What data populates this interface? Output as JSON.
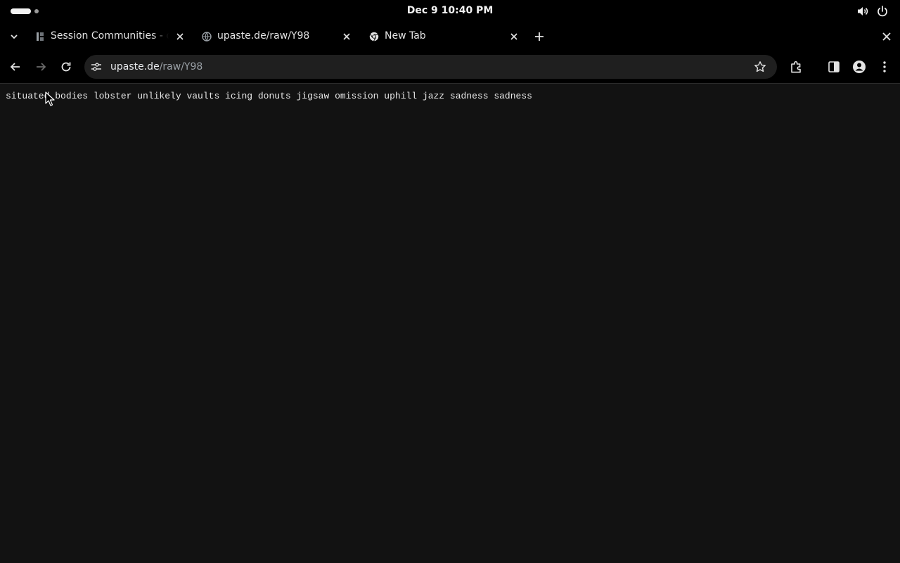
{
  "system_bar": {
    "clock": "Dec 9  10:40 PM",
    "volume_icon": "volume-icon",
    "power_icon": "power-icon"
  },
  "tabs": [
    {
      "title": "Session Communities - o",
      "favicon": "session-icon",
      "active": false
    },
    {
      "title": "upaste.de/raw/Y98",
      "favicon": "globe-icon",
      "active": true
    },
    {
      "title": "New Tab",
      "favicon": "chrome-icon",
      "active": false
    }
  ],
  "address_bar": {
    "host": "upaste.de",
    "path": "/raw/Y98"
  },
  "page": {
    "text": "situated bodies lobster unlikely vaults icing donuts jigsaw omission uphill jazz sadness sadness"
  },
  "colors": {
    "top_bar": "#000000",
    "page_background": "#121212",
    "omnibox": "#1f1f1f"
  }
}
